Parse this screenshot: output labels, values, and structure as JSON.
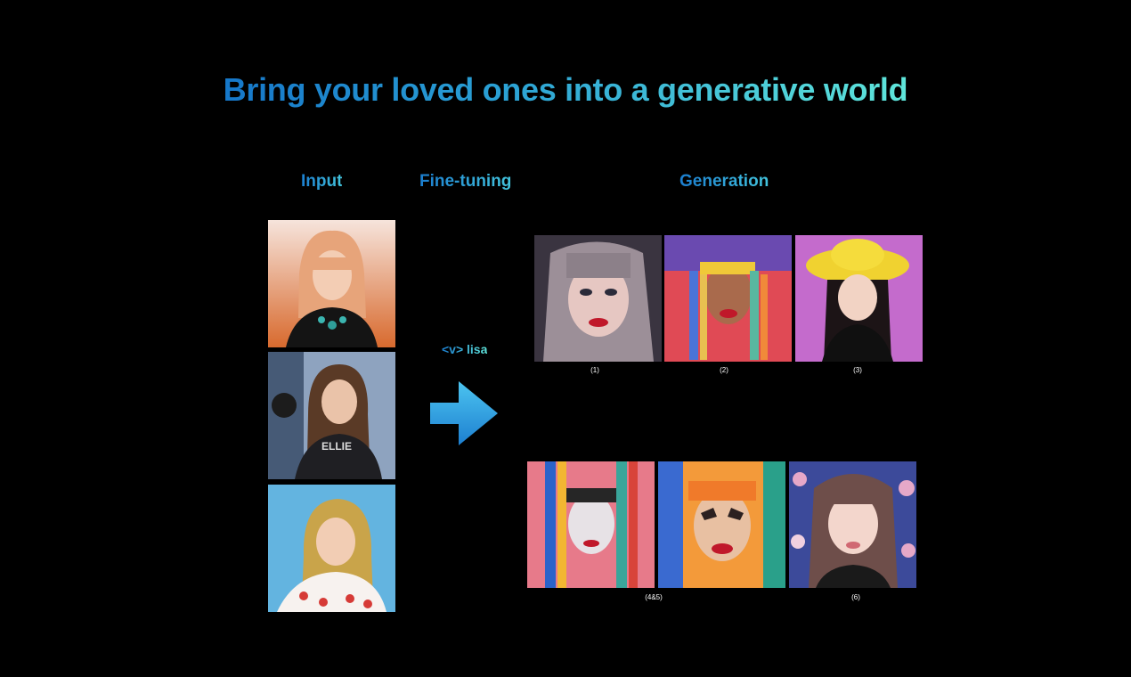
{
  "title": "Bring your loved ones into a generative world",
  "sections": {
    "input": "Input",
    "finetuning": "Fine-tuning",
    "generation": "Generation"
  },
  "token_prompt": "<v> lisa",
  "captions": {
    "c1": "(1)",
    "c2": "(2)",
    "c3": "(3)",
    "c45": "(4&5)",
    "c6": "(6)"
  },
  "colors": {
    "background": "#000000",
    "title_gradient_start": "#1677c9",
    "title_gradient_end": "#5fe6db",
    "arrow": "#2aa0e0"
  },
  "icons": {
    "arrow": "right-arrow-icon"
  }
}
